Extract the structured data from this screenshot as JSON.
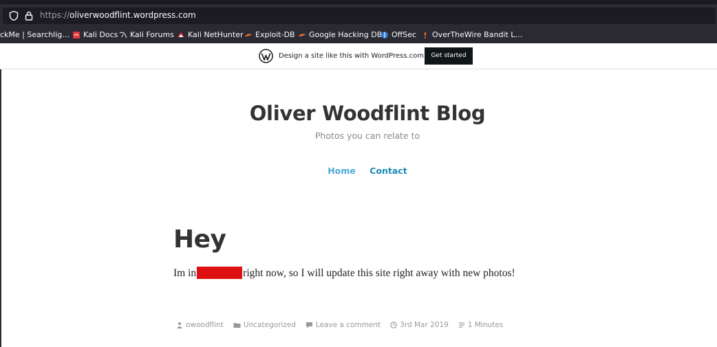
{
  "browser": {
    "url_protocol": "https://",
    "url_host": "oliverwoodflint.wordpress.com",
    "bookmarks": [
      {
        "label": "ckMe | Searchlig…",
        "icon": "none",
        "color": "#fbfbfe"
      },
      {
        "label": "Kali Docs",
        "icon": "kali-docs-icon",
        "color": "#e1373c"
      },
      {
        "label": "Kali Forums",
        "icon": "kali-dragon-icon",
        "color": "#cccccc"
      },
      {
        "label": "Kali NetHunter",
        "icon": "nethunter-icon",
        "color": "#e1373c"
      },
      {
        "label": "Exploit-DB",
        "icon": "exploit-db-icon",
        "color": "#e8762b"
      },
      {
        "label": "Google Hacking DB",
        "icon": "ghdb-icon",
        "color": "#e8762b"
      },
      {
        "label": "OffSec",
        "icon": "offsec-icon",
        "color": "#2f7bd9"
      },
      {
        "label": "OverTheWire Bandit L…",
        "icon": "overthewire-icon",
        "color": "#e8762b"
      }
    ]
  },
  "wp_banner": {
    "text": "Design a site like this with WordPress.com",
    "button": "Get started"
  },
  "site": {
    "title": "Oliver Woodflint Blog",
    "tagline": "Photos you can relate to",
    "nav": [
      "Home",
      "Contact"
    ]
  },
  "post": {
    "title": "Hey",
    "body_before": "Im in",
    "body_after": "right now, so I will update this site right away with new photos!",
    "redaction_color": "#dd1111",
    "meta": {
      "author": "owoodflint",
      "category": "Uncategorized",
      "comments": "Leave a comment",
      "date": "3rd Mar 2019",
      "reading_time": "1 Minutes"
    }
  }
}
